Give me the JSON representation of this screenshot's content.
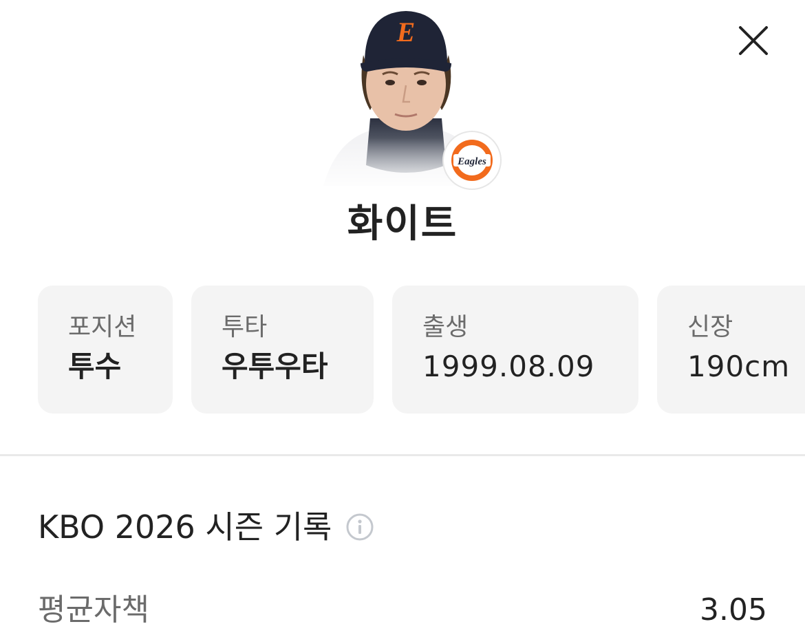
{
  "player": {
    "name": "화이트",
    "cap_letter": "E",
    "team_logo_text": "Eagles"
  },
  "info_cards": [
    {
      "label": "포지션",
      "value": "투수"
    },
    {
      "label": "투타",
      "value": "우투우타"
    },
    {
      "label": "출생",
      "value": "1999.08.09"
    },
    {
      "label": "신장",
      "value": "190cm"
    }
  ],
  "section": {
    "title": "KBO 2026 시즌 기록",
    "icon": "info-icon"
  },
  "stats": [
    {
      "label": "평균자책",
      "value": "3.05"
    }
  ],
  "colors": {
    "accent_orange": "#f26b1d",
    "cap_navy": "#1f2436",
    "card_bg": "#f4f4f4"
  }
}
